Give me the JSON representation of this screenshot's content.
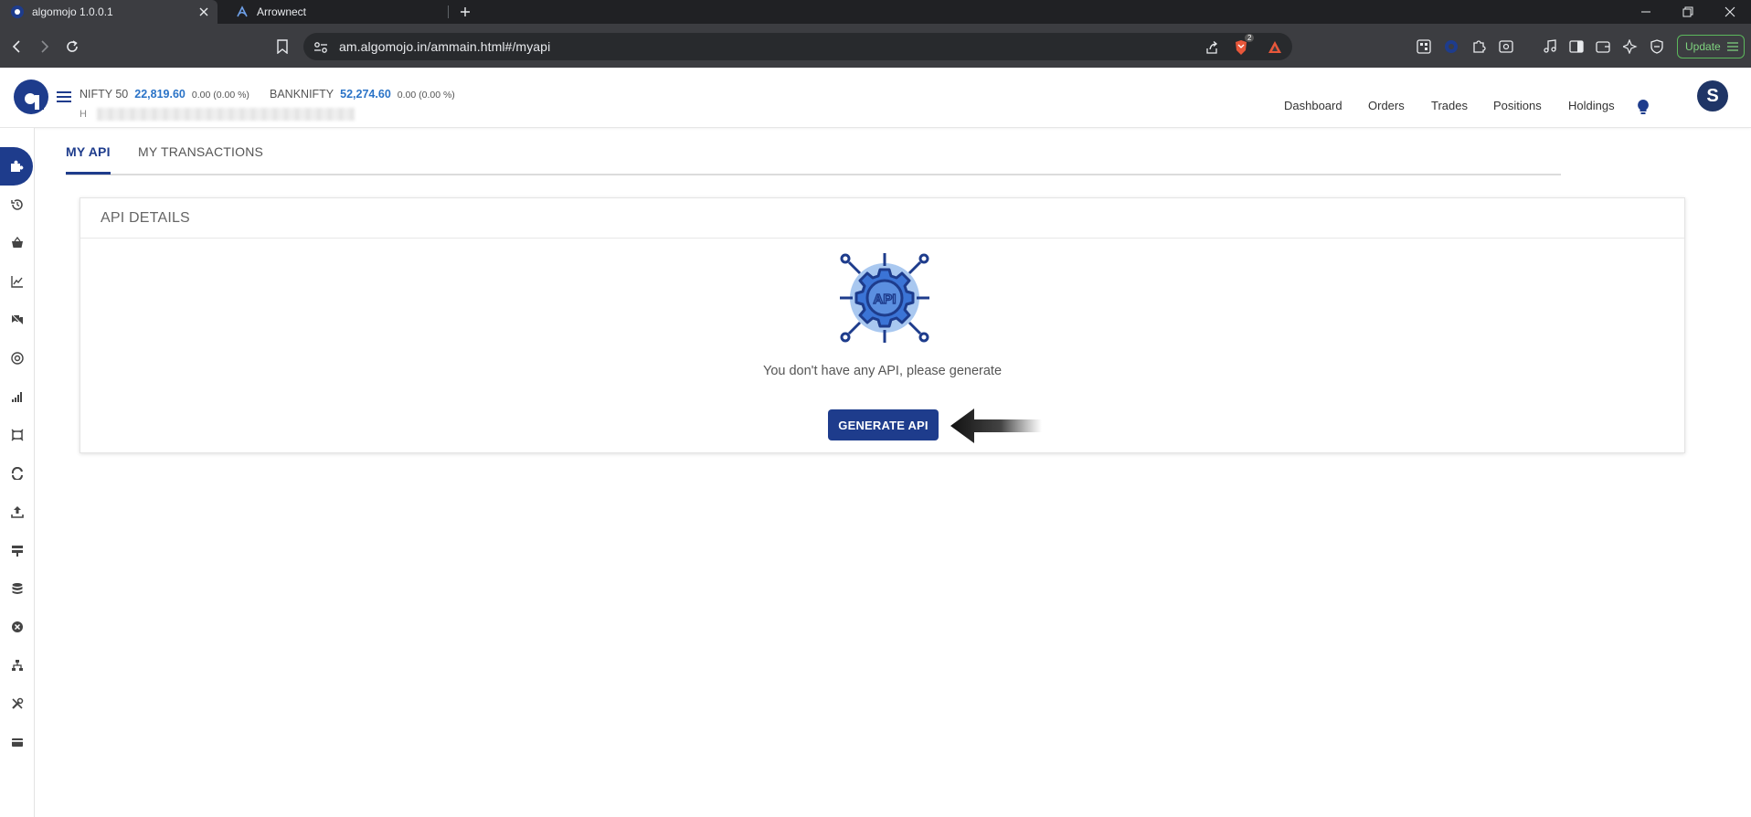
{
  "browser": {
    "tabs": [
      {
        "title": "algomojo 1.0.0.1",
        "active": true
      },
      {
        "title": "Arrownect",
        "active": false
      }
    ],
    "url": "am.algomojo.in/ammain.html#/myapi",
    "shield_badge": "2",
    "update_label": "Update"
  },
  "header": {
    "tickers": [
      {
        "name": "NIFTY 50",
        "price": "22,819.60",
        "change": "0.00 (0.00 %)"
      },
      {
        "name": "BANKNIFTY",
        "price": "52,274.60",
        "change": "0.00 (0.00 %)"
      }
    ],
    "user_prefix": "H",
    "nav": [
      "Dashboard",
      "Orders",
      "Trades",
      "Positions",
      "Holdings"
    ],
    "avatar_initial": "S"
  },
  "content": {
    "tabs": [
      {
        "label": "MY API",
        "active": true
      },
      {
        "label": "MY TRANSACTIONS",
        "active": false
      }
    ],
    "card_title": "API DETAILS",
    "illustration_text": "API",
    "empty_message": "You don't have any API, please generate",
    "generate_button": "GENERATE API"
  },
  "colors": {
    "primary": "#1e3c8c",
    "price": "#2a73c7",
    "browser_bg": "#202124"
  }
}
